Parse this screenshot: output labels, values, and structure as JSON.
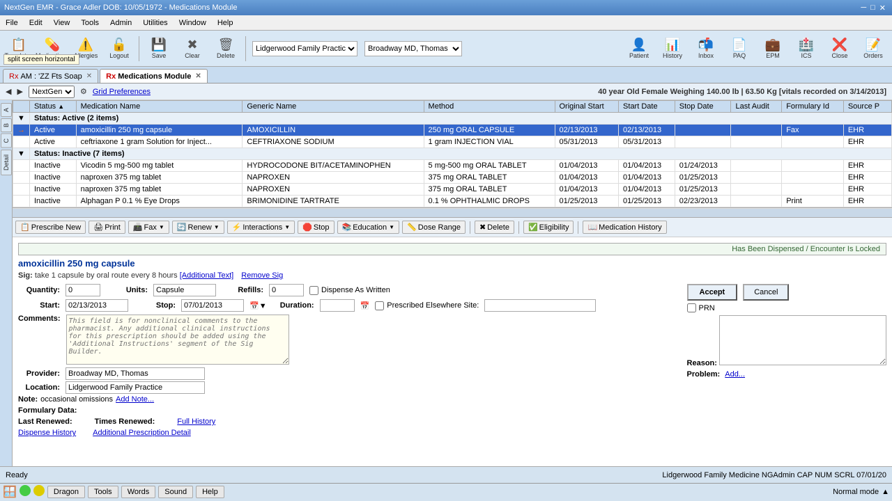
{
  "titleBar": {
    "text": "NextGen EMR - Grace Adler  DOB: 10/05/1972 - Medications Module"
  },
  "menuBar": {
    "items": [
      "File",
      "Edit",
      "View",
      "Tools",
      "Admin",
      "Utilities",
      "Window",
      "Help"
    ]
  },
  "toolbar": {
    "buttons": [
      {
        "id": "templates",
        "label": "Templates",
        "icon": "📋"
      },
      {
        "id": "medications",
        "label": "Medications",
        "icon": "💊"
      },
      {
        "id": "allergies",
        "label": "Allergies",
        "icon": "⚠️"
      },
      {
        "id": "logout",
        "label": "Logout",
        "icon": "🔓"
      },
      {
        "id": "save",
        "label": "Save",
        "icon": "💾"
      },
      {
        "id": "clear",
        "label": "Clear",
        "icon": "✖"
      },
      {
        "id": "delete",
        "label": "Delete",
        "icon": "🗑"
      }
    ],
    "providers": {
      "practice": "Lidgerwood Family Practic",
      "provider": "Broadway MD, Thomas"
    },
    "rightButtons": [
      {
        "id": "patient",
        "label": "Patient",
        "icon": "👤"
      },
      {
        "id": "history",
        "label": "History",
        "icon": "📊"
      },
      {
        "id": "inbox",
        "label": "Inbox",
        "icon": "📬"
      },
      {
        "id": "paq",
        "label": "PAQ",
        "icon": "📄"
      },
      {
        "id": "epm",
        "label": "EPM",
        "icon": "💼"
      },
      {
        "id": "ics",
        "label": "ICS",
        "icon": "🏥"
      },
      {
        "id": "close",
        "label": "Close",
        "icon": "❌"
      },
      {
        "id": "orders",
        "label": "Orders",
        "icon": "📝"
      }
    ]
  },
  "tabs": [
    {
      "id": "soap",
      "label": "AM : 'ZZ Fts Soap",
      "active": false,
      "closable": true
    },
    {
      "id": "medications",
      "label": "Medications Module",
      "active": true,
      "closable": true
    }
  ],
  "infoBar": {
    "text": "40 year Old Female Weighing 140.00 lb  |  63.50 Kg [vitals recorded on 3/14/2013]"
  },
  "secondToolbar": {
    "nextgenLabel": "NextGen",
    "gridPrefsLabel": "Grid Preferences"
  },
  "tableColumns": [
    "",
    "Status",
    "Medication Name",
    "Generic Name",
    "Method",
    "Original Start",
    "Start Date",
    "Stop Date",
    "Last Audit",
    "Formulary Id",
    "Source P"
  ],
  "medicationGroups": [
    {
      "status": "Active",
      "count": 2,
      "label": "Status: Active (2 items)",
      "items": [
        {
          "selected": true,
          "arrow": "→",
          "status": "Active",
          "medicationName": "amoxicillin 250 mg capsule",
          "genericName": "AMOXICILLIN",
          "method": "250 mg ORAL CAPSULE",
          "originalStart": "02/13/2013",
          "startDate": "02/13/2013",
          "stopDate": "",
          "lastAudit": "",
          "formularyId": "Fax",
          "sourceP": "EHR"
        },
        {
          "selected": false,
          "arrow": "",
          "status": "Active",
          "medicationName": "ceftriaxone 1 gram Solution for Inject...",
          "genericName": "CEFTRIAXONE SODIUM",
          "method": "1 gram INJECTION VIAL",
          "originalStart": "05/31/2013",
          "startDate": "05/31/2013",
          "stopDate": "",
          "lastAudit": "",
          "formularyId": "",
          "sourceP": "EHR"
        }
      ]
    },
    {
      "status": "Inactive",
      "count": 7,
      "label": "Status: Inactive (7 items)",
      "items": [
        {
          "status": "Inactive",
          "medicationName": "Vicodin 5 mg-500 mg tablet",
          "genericName": "HYDROCODONE BIT/ACETAMINOPHEN",
          "method": "5 mg-500 mg ORAL TABLET",
          "originalStart": "01/04/2013",
          "startDate": "01/04/2013",
          "stopDate": "01/24/2013",
          "lastAudit": "",
          "formularyId": "",
          "sourceP": "EHR"
        },
        {
          "status": "Inactive",
          "medicationName": "naproxen 375 mg tablet",
          "genericName": "NAPROXEN",
          "method": "375 mg ORAL TABLET",
          "originalStart": "01/04/2013",
          "startDate": "01/04/2013",
          "stopDate": "01/25/2013",
          "lastAudit": "",
          "formularyId": "",
          "sourceP": "EHR"
        },
        {
          "status": "Inactive",
          "medicationName": "naproxen 375 mg tablet",
          "genericName": "NAPROXEN",
          "method": "375 mg ORAL TABLET",
          "originalStart": "01/04/2013",
          "startDate": "01/04/2013",
          "stopDate": "01/25/2013",
          "lastAudit": "",
          "formularyId": "",
          "sourceP": "EHR"
        },
        {
          "status": "Inactive",
          "medicationName": "Alphagan P 0.1 % Eye Drops",
          "genericName": "BRIMONIDINE TARTRATE",
          "method": "0.1 % OPHTHALMIC DROPS",
          "originalStart": "01/25/2013",
          "startDate": "01/25/2013",
          "stopDate": "02/23/2013",
          "lastAudit": "",
          "formularyId": "Print",
          "sourceP": "EHR"
        }
      ]
    }
  ],
  "actionToolbar": {
    "buttons": [
      {
        "id": "prescribe-new",
        "label": "Prescribe New",
        "icon": "📋"
      },
      {
        "id": "print",
        "label": "Print",
        "icon": "🖨"
      },
      {
        "id": "fax",
        "label": "Fax",
        "icon": "📠"
      },
      {
        "id": "renew",
        "label": "Renew",
        "icon": "🔄"
      },
      {
        "id": "interactions",
        "label": "Interactions",
        "icon": "⚡"
      },
      {
        "id": "stop",
        "label": "Stop",
        "icon": "🛑"
      },
      {
        "id": "education",
        "label": "Education",
        "icon": "📚"
      },
      {
        "id": "dose-range",
        "label": "Dose Range",
        "icon": "📏"
      },
      {
        "id": "delete-action",
        "label": "Delete",
        "icon": "✖"
      },
      {
        "id": "eligibility",
        "label": "Eligibility",
        "icon": "✅"
      },
      {
        "id": "medication-history",
        "label": "Medication History",
        "icon": "📖"
      }
    ]
  },
  "detailPanel": {
    "dispensedNotice": "Has Been Dispensed / Encounter Is Locked",
    "title": "amoxicillin 250 mg capsule",
    "sig": {
      "label": "Sig:",
      "text": "  take 1 capsule by oral route  every 8 hours",
      "additionalTextLink": "[Additional Text]",
      "removeLink": "Remove Sig"
    },
    "quantity": {
      "label": "Quantity:",
      "value": "0"
    },
    "units": {
      "label": "Units:",
      "value": "Capsule"
    },
    "refills": {
      "label": "Refills:",
      "value": "0"
    },
    "dispenseAsWritten": {
      "label": "Dispense As Written",
      "checked": false
    },
    "start": {
      "label": "Start:",
      "value": "02/13/2013"
    },
    "stop": {
      "label": "Stop:",
      "value": "07/01/2013"
    },
    "duration": {
      "label": "Duration:"
    },
    "prescribedElsewhere": {
      "label": "Prescribed Elsewhere Site:",
      "checked": false,
      "value": ""
    },
    "prn": {
      "label": "PRN",
      "checked": false
    },
    "reason": {
      "label": "Reason:"
    },
    "problem": {
      "label": "Problem:",
      "value": "Add..."
    },
    "comments": {
      "label": "Comments:",
      "placeholder": "This field is for nonclinical comments to the pharmacist. Any additional clinical instructions for this prescription should be added using the 'Additional Instructions' segment of the Sig Builder."
    },
    "provider": {
      "label": "Provider:",
      "value": "Broadway MD, Thomas"
    },
    "location": {
      "label": "Location:",
      "value": "Lidgerwood Family Practice"
    },
    "note": {
      "label": "Note:",
      "value": "occasional omissions",
      "addNoteLink": "Add Note..."
    },
    "formularyData": {
      "label": "Formulary Data:"
    },
    "lastRenewed": {
      "label": "Last Renewed:",
      "value": ""
    },
    "timesRenewed": {
      "label": "Times Renewed:",
      "value": ""
    },
    "fullHistory": {
      "label": "Full History"
    },
    "dispenseHistory": {
      "label": "Dispense History"
    },
    "additionalDetail": {
      "label": "Additional Prescription Detail"
    }
  },
  "statusBar": {
    "left": "Ready",
    "right": "Lidgerwood Family Medicine  NGAdmin     CAP  NUM  SCRL  07/01/20"
  },
  "taskbar": {
    "items": [
      {
        "id": "start",
        "label": ""
      },
      {
        "id": "dragon",
        "label": "Dragon"
      },
      {
        "id": "tools",
        "label": "Tools"
      },
      {
        "id": "words",
        "label": "Words"
      },
      {
        "id": "sound",
        "label": "Sound"
      },
      {
        "id": "help",
        "label": "Help"
      }
    ],
    "mode": "Normal mode"
  },
  "splitScreenTooltip": "split screen horizontal"
}
